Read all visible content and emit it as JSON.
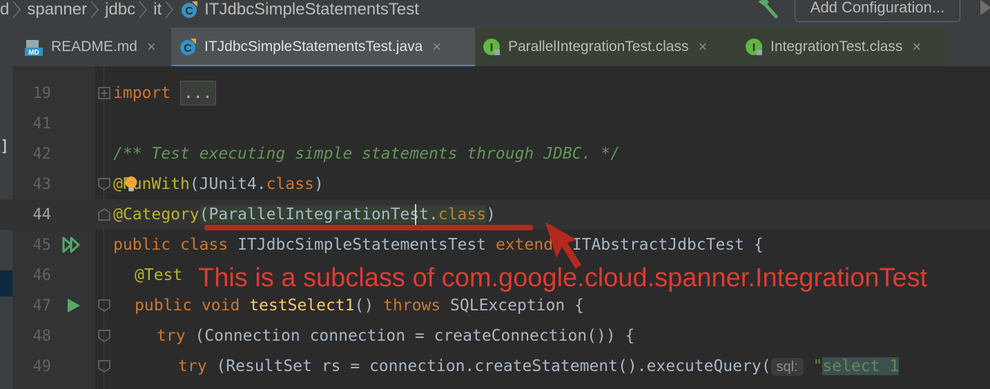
{
  "breadcrumb": {
    "items": [
      "d",
      "spanner",
      "jdbc",
      "it",
      "ITJdbcSimpleStatementsTest"
    ]
  },
  "toolbar": {
    "add_configuration_label": "Add Configuration..."
  },
  "tabs": [
    {
      "label": "README.md",
      "icon": "markdown-file-icon",
      "active": false
    },
    {
      "label": "ITJdbcSimpleStatementsTest.java",
      "icon": "java-class-icon",
      "active": true
    },
    {
      "label": "ParallelIntegrationTest.class",
      "icon": "interface-class-icon",
      "active": false
    },
    {
      "label": "IntegrationTest.class",
      "icon": "interface-class-icon",
      "active": false
    }
  ],
  "editor": {
    "current_line": "44",
    "lines": [
      {
        "num": "19"
      },
      {
        "num": "41"
      },
      {
        "num": "42"
      },
      {
        "num": "43"
      },
      {
        "num": "44"
      },
      {
        "num": "45"
      },
      {
        "num": "46"
      },
      {
        "num": "47"
      },
      {
        "num": "48"
      },
      {
        "num": "49"
      }
    ],
    "code": {
      "l19_import": "import",
      "l19_fold": "...",
      "l42_comment": "/** Test executing simple statements through JDBC. */",
      "l43_at": "@",
      "l43_ann": "RunWith",
      "l43_rest_a": "(JUnit4.",
      "l43_class": "class",
      "l43_rest_b": ")",
      "l44_ann": "@Category",
      "l44_paren": "(",
      "l44_type": "ParallelIntegrationTest",
      "l44_dot": ".",
      "l44_class": "class",
      "l44_close": ")",
      "l45_public": "public",
      "l45_class": "class",
      "l45_name": "ITJdbcSimpleStatementsTest",
      "l45_extends": "extends",
      "l45_super": "ITAbstractJdbcTest {",
      "l46_ann": "@Test",
      "l47_public": "public",
      "l47_void": "void",
      "l47_method": "testSelect1",
      "l47_rest": "()",
      "l47_throws": "throws",
      "l47_exc": "SQLException {",
      "l48_try": "try",
      "l48_rest": "(Connection connection = createConnection()) {",
      "l49_try": "try",
      "l49_rest": "(ResultSet rs = connection.createStatement().executeQuery(",
      "l49_hint": "sql:",
      "l49_str_open": "\"",
      "l49_str": "select 1"
    }
  },
  "overlay": {
    "annotation_text": "This is a subclass of com.google.cloud.spanner.IntegrationTest"
  },
  "colors": {
    "annotation_red": "#e03c31",
    "active_tab_underline": "#4a88c7",
    "keyword": "#cc7832",
    "annotation": "#bbb529",
    "comment": "#629755"
  }
}
